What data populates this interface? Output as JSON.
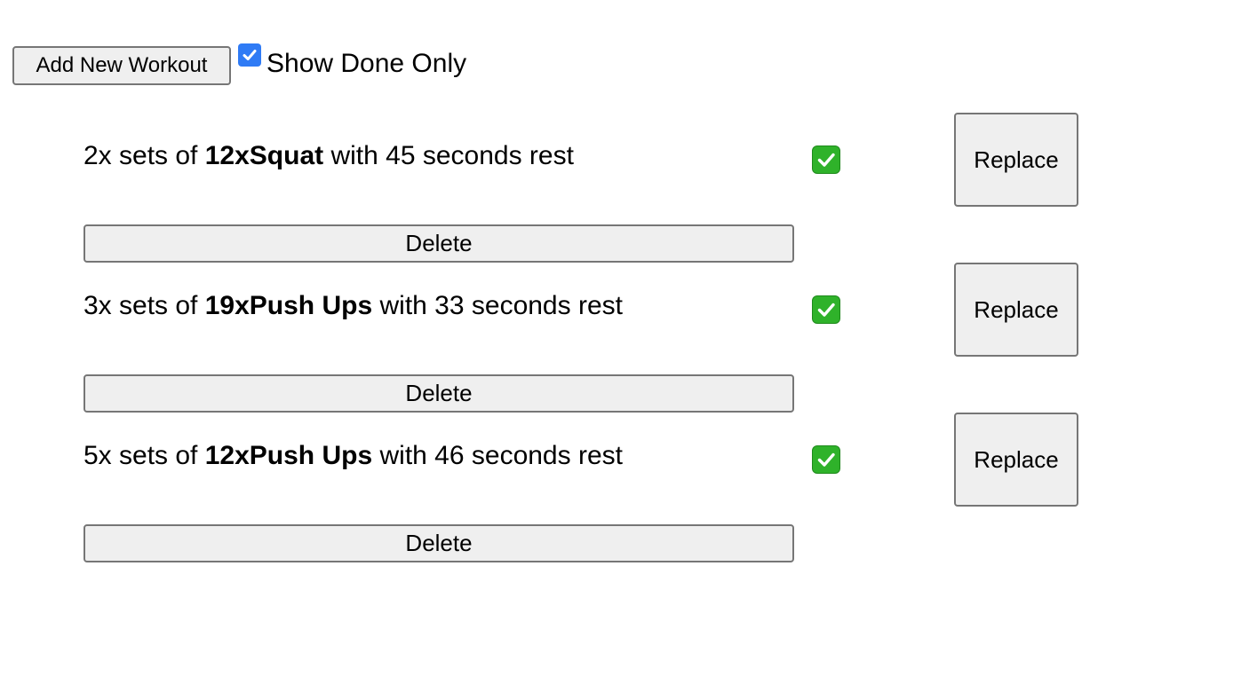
{
  "toolbar": {
    "add_label": "Add New Workout",
    "show_done_label": "Show Done Only",
    "show_done_checked": true
  },
  "workouts": [
    {
      "prefix": "2x sets of ",
      "exercise": "12xSquat",
      "suffix": " with 45 seconds rest",
      "done_icon": "check-mark-button-icon",
      "replace_label": "Replace",
      "delete_label": "Delete"
    },
    {
      "prefix": "3x sets of ",
      "exercise": "19xPush Ups",
      "suffix": " with 33 seconds rest",
      "done_icon": "check-mark-button-icon",
      "replace_label": "Replace",
      "delete_label": "Delete"
    },
    {
      "prefix": "5x sets of ",
      "exercise": "12xPush Ups",
      "suffix": " with 46 seconds rest",
      "done_icon": "check-mark-button-icon",
      "replace_label": "Replace",
      "delete_label": "Delete"
    }
  ],
  "colors": {
    "checkbox_accent": "#2f7bf5",
    "done_icon_green": "#2fb22a",
    "button_bg": "#efefef",
    "button_border": "#767676"
  }
}
